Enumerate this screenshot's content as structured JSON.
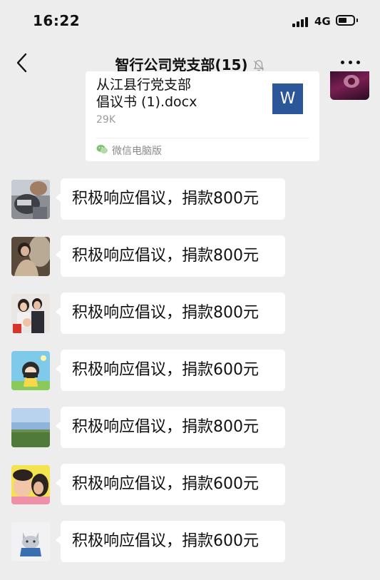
{
  "status_bar": {
    "time": "16:22",
    "network": "4G"
  },
  "nav": {
    "title": "智行公司党支部(15)"
  },
  "file_card": {
    "name_cut": "从江县行党支部",
    "name": "倡议书 (1).docx",
    "size": "29K",
    "icon_letter": "W",
    "source": "微信电脑版"
  },
  "messages": [
    {
      "text": "积极响应倡议，捐款800元",
      "avatar": "avatar-1"
    },
    {
      "text": "积极响应倡议，捐款800元",
      "avatar": "avatar-2"
    },
    {
      "text": "积极响应倡议，捐款800元",
      "avatar": "avatar-3"
    },
    {
      "text": "积极响应倡议，捐款600元",
      "avatar": "avatar-4"
    },
    {
      "text": "积极响应倡议，捐款800元",
      "avatar": "avatar-5"
    },
    {
      "text": "积极响应倡议，捐款600元",
      "avatar": "avatar-6"
    },
    {
      "text": "积极响应倡议，捐款600元",
      "avatar": "avatar-7"
    }
  ],
  "colors": {
    "background": "#ededed",
    "bubble": "#ffffff",
    "word_blue": "#2b579a"
  }
}
